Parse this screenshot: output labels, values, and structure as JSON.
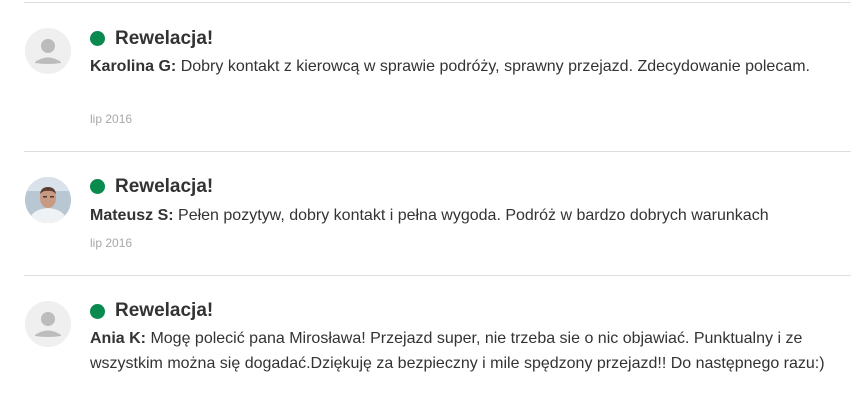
{
  "colors": {
    "rating_dot": "#0a8a4f",
    "text": "#333333",
    "date": "#a8a8a8",
    "divider": "#dedede"
  },
  "reviews": [
    {
      "avatar": "default-user-icon",
      "rating_label": "Rewelacja!",
      "author": "Karolina G:",
      "text": "Dobry kontakt z kierowcą w sprawie podróży, sprawny przejazd. Zdecydowanie polecam.",
      "date": "lip 2016"
    },
    {
      "avatar": "user-photo",
      "rating_label": "Rewelacja!",
      "author": "Mateusz S:",
      "text": "Pełen pozytyw, dobry kontakt i pełna wygoda. Podróż w bardzo dobrych warunkach",
      "date": "lip 2016"
    },
    {
      "avatar": "default-user-icon",
      "rating_label": "Rewelacja!",
      "author": "Ania K:",
      "text": "Mogę polecić pana Mirosława! Przejazd super, nie trzeba sie o nic objawiać. Punktualny i ze wszystkim można się dogadać.Dziękuję za bezpieczny i mile spędzony przejazd!! Do następnego razu:)"
    }
  ]
}
